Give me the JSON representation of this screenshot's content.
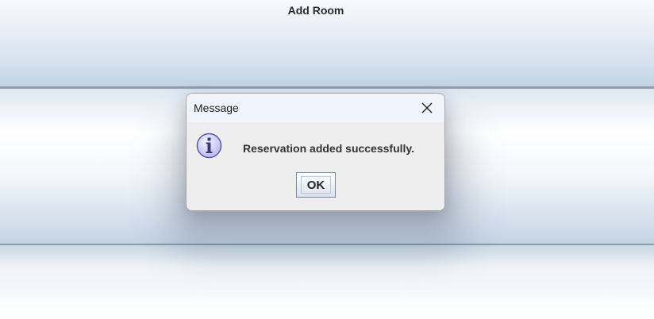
{
  "app": {
    "panel_title": "Add Room"
  },
  "dialog": {
    "title": "Message",
    "message": "Reservation added successfully.",
    "ok_label": "OK",
    "icon": "info-icon",
    "close_icon": "close-icon"
  },
  "colors": {
    "panel_top_light": "#f7f9fc",
    "panel_top_dark": "#c3d5e6",
    "dialog_bg": "#eeeeee",
    "dialog_titlebar_bg": "#f0f3f9",
    "info_icon_fill": "#c9c9f5",
    "info_icon_stroke": "#5a5aa8"
  }
}
